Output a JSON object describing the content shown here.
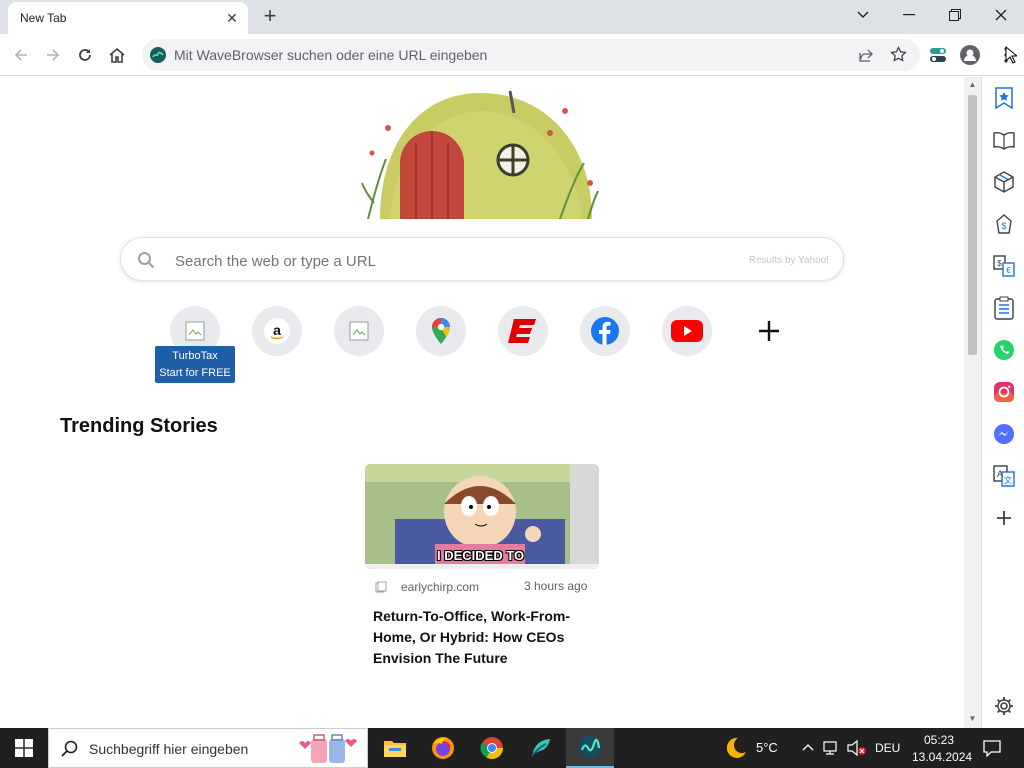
{
  "browser": {
    "tab": {
      "title": "New Tab"
    },
    "omnibox": {
      "placeholder": "Mit WaveBrowser suchen oder eine URL eingeben"
    }
  },
  "newtab": {
    "search": {
      "placeholder": "Search the web or type a URL",
      "provider": "Results by Yahoo!"
    },
    "shortcuts": [
      {
        "icon": "broken-image-icon"
      },
      {
        "icon": "amazon-icon"
      },
      {
        "icon": "broken-image-icon"
      },
      {
        "icon": "google-maps-icon"
      },
      {
        "icon": "espn-icon"
      },
      {
        "icon": "facebook-icon"
      },
      {
        "icon": "youtube-icon"
      },
      {
        "icon": "add-icon"
      }
    ],
    "tooltip": {
      "line1": "TurboTax",
      "line2": "Start for FREE"
    },
    "trending": {
      "heading": "Trending Stories",
      "story": {
        "image_caption": "I DECIDED TO",
        "source": "earlychirp.com",
        "time": "3 hours ago",
        "title": "Return-To-Office, Work-From-Home, Or Hybrid: How CEOs Envision The Future"
      }
    }
  },
  "sidepanel": {
    "icons": [
      "bookmark-star-icon",
      "reading-icon",
      "box-icon",
      "shopping-icon",
      "currency-convert-icon",
      "checklist-icon",
      "whatsapp-icon",
      "instagram-icon",
      "messenger-icon",
      "translate-icon",
      "add-icon",
      "settings-icon"
    ]
  },
  "taskbar": {
    "search_placeholder": "Suchbegriff hier eingeben",
    "weather": "5°C",
    "language": "DEU",
    "time": "05:23",
    "date": "13.04.2024"
  },
  "colors": {
    "accent_blue": "#1f5fa8",
    "taskbar_bg": "#202020",
    "tab_strip": "#dee1e6"
  }
}
